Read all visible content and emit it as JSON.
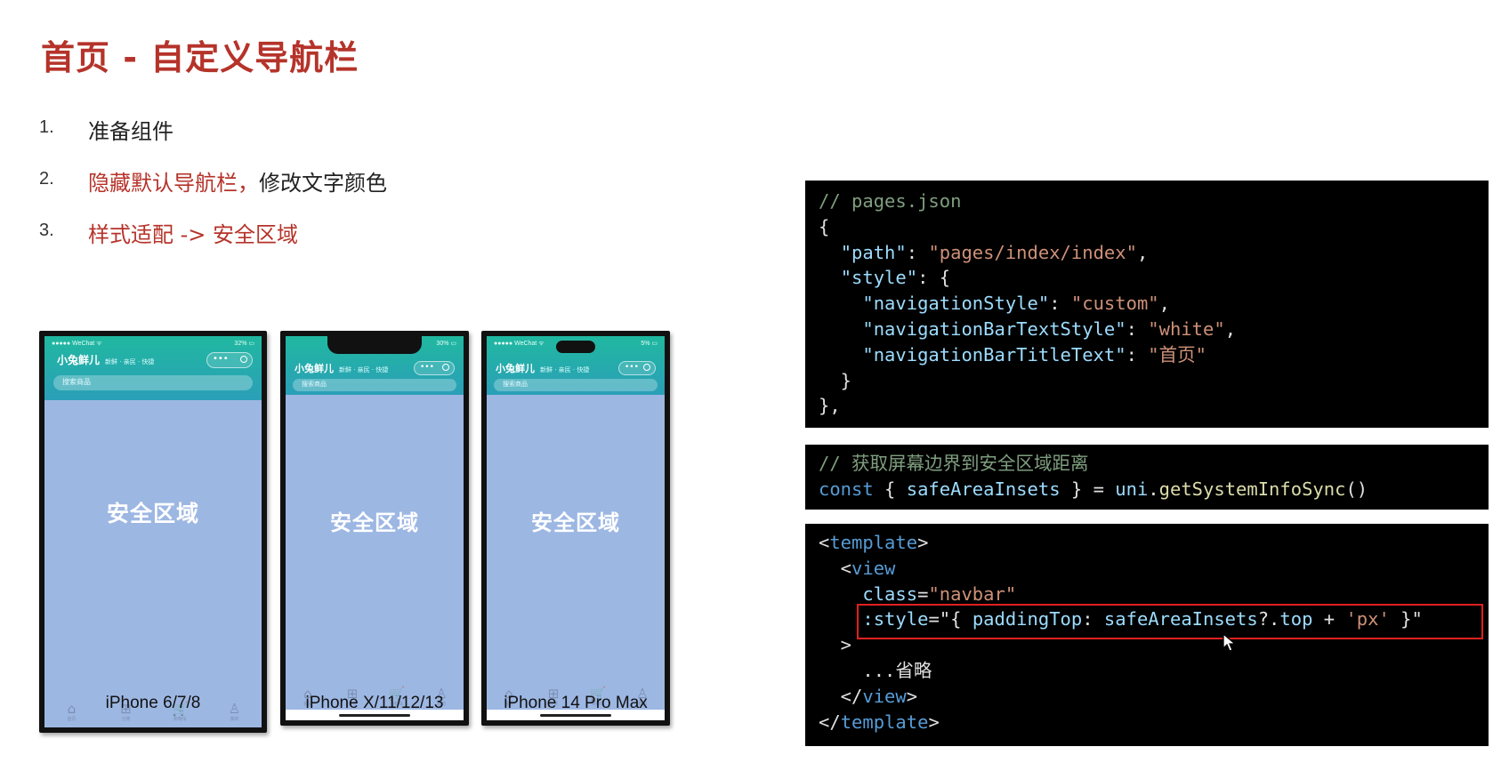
{
  "title": "首页 - 自定义导航栏",
  "steps": [
    {
      "num": "1.",
      "parts": [
        {
          "text": "准备组件",
          "color": "dark"
        }
      ]
    },
    {
      "num": "2.",
      "parts": [
        {
          "text": "隐藏默认导航栏，",
          "color": "red"
        },
        {
          "text": "修改文字颜色",
          "color": "dark"
        }
      ]
    },
    {
      "num": "3.",
      "parts": [
        {
          "text": "样式适配 -> 安全区域",
          "color": "red"
        }
      ]
    }
  ],
  "phones": [
    {
      "caption": "iPhone 6/7/8",
      "status_left": "●●●●● WeChat ᯤ",
      "status_right": "32% ▭",
      "brand": "小兔鲜儿",
      "brand_sub": "新鲜 · 亲民 · 快捷",
      "search_placeholder": "搜索商品",
      "safe_label": "安全区域",
      "tabs": [
        {
          "icon": "home-icon",
          "glyph": "⌂",
          "label": "首页"
        },
        {
          "icon": "category-icon",
          "glyph": "⊞",
          "label": "分类"
        },
        {
          "icon": "cart-icon",
          "glyph": "🛒",
          "label": "购物车"
        },
        {
          "icon": "user-icon",
          "glyph": "♙",
          "label": "我的"
        }
      ]
    },
    {
      "caption": "iPhone X/11/12/13",
      "status_left": "",
      "status_right": "30% ▭",
      "brand": "小兔鲜儿",
      "brand_sub": "新鲜 · 亲民 · 快捷",
      "search_placeholder": "搜索商品",
      "safe_label": "安全区域",
      "tabs": [
        {
          "icon": "home-icon",
          "glyph": "⌂",
          "label": "首页"
        },
        {
          "icon": "category-icon",
          "glyph": "⊞",
          "label": "分类"
        },
        {
          "icon": "cart-icon",
          "glyph": "🛒",
          "label": "购物车"
        },
        {
          "icon": "user-icon",
          "glyph": "♙",
          "label": "我的"
        }
      ]
    },
    {
      "caption": "iPhone 14 Pro Max",
      "status_left": "●●●●● WeChat ᯤ",
      "status_right": "5% ▭",
      "brand": "小兔鲜儿",
      "brand_sub": "新鲜 · 亲民 · 快捷",
      "search_placeholder": "搜索商品",
      "safe_label": "安全区域",
      "tabs": [
        {
          "icon": "home-icon",
          "glyph": "⌂",
          "label": "首页"
        },
        {
          "icon": "category-icon",
          "glyph": "⊞",
          "label": "分类"
        },
        {
          "icon": "cart-icon",
          "glyph": "🛒",
          "label": "购物车"
        },
        {
          "icon": "user-icon",
          "glyph": "♙",
          "label": "我的"
        }
      ]
    }
  ],
  "code_blocks": [
    [
      [
        [
          "comment",
          "// pages.json"
        ]
      ],
      [
        [
          "plain",
          "{"
        ]
      ],
      [
        [
          "plain",
          "  "
        ],
        [
          "key",
          "\"path\""
        ],
        [
          "plain",
          ": "
        ],
        [
          "str",
          "\"pages/index/index\""
        ],
        [
          "plain",
          ","
        ]
      ],
      [
        [
          "plain",
          "  "
        ],
        [
          "key",
          "\"style\""
        ],
        [
          "plain",
          ": {"
        ]
      ],
      [
        [
          "plain",
          "    "
        ],
        [
          "key",
          "\"navigationStyle\""
        ],
        [
          "plain",
          ": "
        ],
        [
          "str",
          "\"custom\""
        ],
        [
          "plain",
          ","
        ]
      ],
      [
        [
          "plain",
          "    "
        ],
        [
          "key",
          "\"navigationBarTextStyle\""
        ],
        [
          "plain",
          ": "
        ],
        [
          "str",
          "\"white\""
        ],
        [
          "plain",
          ","
        ]
      ],
      [
        [
          "plain",
          "    "
        ],
        [
          "key",
          "\"navigationBarTitleText\""
        ],
        [
          "plain",
          ": "
        ],
        [
          "str",
          "\"首页\""
        ]
      ],
      [
        [
          "plain",
          "  }"
        ]
      ],
      [
        [
          "plain",
          "},"
        ]
      ]
    ],
    [
      [
        [
          "comment",
          "// 获取屏幕边界到安全区域距离"
        ]
      ],
      [
        [
          "kw",
          "const"
        ],
        [
          "plain",
          " { "
        ],
        [
          "key",
          "safeAreaInsets"
        ],
        [
          "plain",
          " } = "
        ],
        [
          "key",
          "uni"
        ],
        [
          "plain",
          "."
        ],
        [
          "func",
          "getSystemInfoSync"
        ],
        [
          "plain",
          "()"
        ]
      ]
    ],
    [
      [
        [
          "plain",
          "<"
        ],
        [
          "tag",
          "template"
        ],
        [
          "plain",
          ">"
        ]
      ],
      [
        [
          "plain",
          "  <"
        ],
        [
          "tag",
          "view"
        ]
      ],
      [
        [
          "plain",
          "    "
        ],
        [
          "attr",
          "class"
        ],
        [
          "plain",
          "="
        ],
        [
          "str",
          "\"navbar\""
        ]
      ],
      [
        [
          "plain",
          "    "
        ],
        [
          "attr",
          ":style"
        ],
        [
          "plain",
          "=\"{ "
        ],
        [
          "key",
          "paddingTop"
        ],
        [
          "plain",
          ": "
        ],
        [
          "key",
          "safeAreaInsets"
        ],
        [
          "plain",
          "?."
        ],
        [
          "key",
          "top"
        ],
        [
          "plain",
          " + "
        ],
        [
          "str",
          "'px'"
        ],
        [
          "plain",
          " }\""
        ]
      ],
      [
        [
          "plain",
          "  >"
        ]
      ],
      [
        [
          "plain",
          "    ...省略"
        ]
      ],
      [
        [
          "plain",
          "  </"
        ],
        [
          "tag",
          "view"
        ],
        [
          "plain",
          ">"
        ]
      ],
      [
        [
          "plain",
          "</"
        ],
        [
          "tag",
          "template"
        ],
        [
          "plain",
          ">"
        ]
      ]
    ]
  ]
}
